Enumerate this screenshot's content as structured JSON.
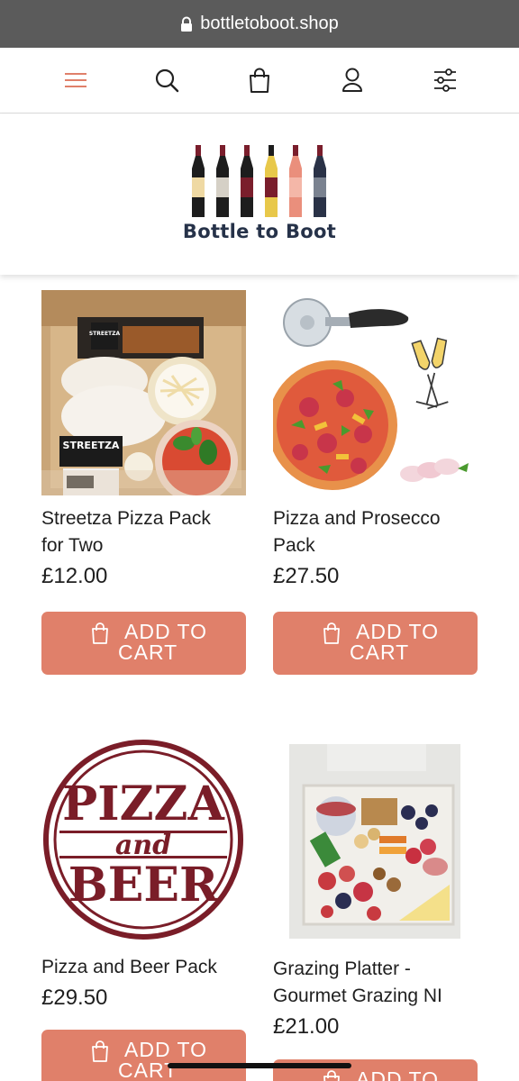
{
  "browser": {
    "url": "bottletoboot.shop"
  },
  "brand": {
    "name": "Bottle to Boot",
    "accent": "#e0806a",
    "navy": "#263249",
    "bottle_colors": [
      "#efd9a3",
      "#d5d0c6",
      "#7a1e2c",
      "#e8c84a",
      "#ea8f7c",
      "#7a8290"
    ]
  },
  "nav": {
    "icons": [
      "menu-icon",
      "search-icon",
      "bag-icon",
      "user-icon",
      "filter-icon"
    ]
  },
  "products": [
    {
      "title_l1": "Streetza Pizza Pack",
      "title_l2": "for Two",
      "price": "£12.00",
      "button_l1": "ADD TO",
      "button_l2": "CART",
      "image_text": "STREETZA"
    },
    {
      "title_l1": "Pizza and Prosecco",
      "title_l2": "Pack",
      "price": "£27.50",
      "button_l1": "ADD TO",
      "button_l2": "CART"
    },
    {
      "title_l1": "Pizza and Beer Pack",
      "price": "£29.50",
      "button_l1": "ADD TO",
      "button_l2": "CART",
      "image_text": {
        "top": "PIZZA",
        "mid": "and",
        "bottom": "BEER"
      }
    },
    {
      "title_l1": "Grazing Platter -",
      "title_l2": "Gourmet Grazing NI",
      "price": "£21.00",
      "button_l1": "ADD TO"
    }
  ]
}
